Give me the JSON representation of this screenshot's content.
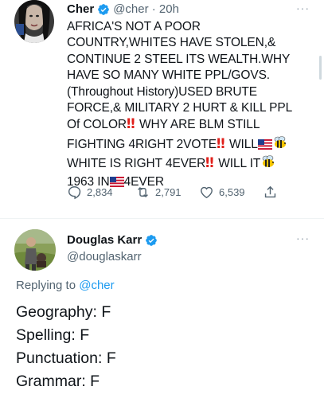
{
  "tweet": {
    "author_name": "Cher",
    "handle_time": "@cher · 20h",
    "more": "···",
    "text_lines": [
      "AFRICA'S NOT A POOR",
      "COUNTRY,WHITES HAVE STOLEN,&",
      "CONTINUE 2 STEEL ITS WEALTH.WHY",
      "HAVE SO MANY WHITE PPL/GOVS.",
      "(Throughout History)USED BRUTE",
      "FORCE,& MILITARY 2 HURT & KILL PPL"
    ],
    "line7_a": "Of COLOR",
    "line7_b": "WHY ARE BLM STILL",
    "line8_a": "FIGHTING 4RIGHT 2VOTE",
    "line8_b": "WILL",
    "line9_a": "WHITE IS RIGHT 4EVER",
    "line9_b": "WILL IT",
    "line10_a": "1963 IN",
    "line10_b": "4EVER",
    "reply_count": "2,834",
    "retweet_count": "2,791",
    "like_count": "6,539"
  },
  "reply": {
    "author_name": "Douglas Karr",
    "handle": "@douglaskarr",
    "more": "···",
    "replying_prefix": "Replying to ",
    "replying_handle": "@cher",
    "lines": [
      "Geography: F",
      "Spelling: F",
      "Punctuation: F",
      "Grammar: F"
    ]
  },
  "colors": {
    "verified": "#1d9bf0",
    "link": "#1d9bf0",
    "muted": "#536471",
    "interrobang": "#e0201b"
  }
}
